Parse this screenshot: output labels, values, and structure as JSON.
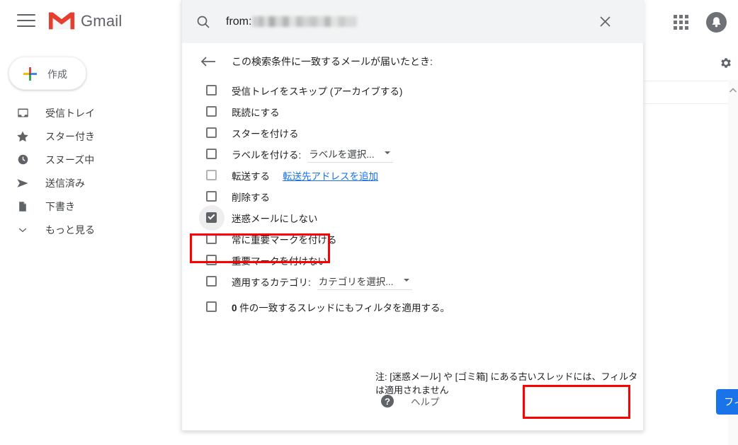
{
  "appbar": {
    "menu_icon": "hamburger-menu-icon",
    "logo_icon": "gmail-logo-icon",
    "brand": "Gmail",
    "apps_icon": "apps-grid-icon",
    "avatar_icon": "bell-avatar-icon"
  },
  "sidebar": {
    "compose": {
      "label": "作成",
      "icon": "plus-icon"
    },
    "items": [
      {
        "label": "受信トレイ",
        "icon": "inbox-icon"
      },
      {
        "label": "スター付き",
        "icon": "star-icon"
      },
      {
        "label": "スヌーズ中",
        "icon": "clock-icon"
      },
      {
        "label": "送信済み",
        "icon": "send-icon"
      },
      {
        "label": "下書き",
        "icon": "document-icon"
      },
      {
        "label": "もっと見る",
        "icon": "chevron-down-icon"
      }
    ]
  },
  "background": {
    "settings_icon": "gear-icon",
    "scroll_up_icon": "chevron-up-icon"
  },
  "search": {
    "icon": "search-icon",
    "query_prefix": "from:",
    "query_redacted": true,
    "close_icon": "close-icon"
  },
  "panel": {
    "back_icon": "back-arrow-icon",
    "title": "この検索条件に一致するメールが届いたとき:",
    "options": [
      {
        "label": "受信トレイをスキップ (アーカイブする)",
        "checked": false
      },
      {
        "label": "既読にする",
        "checked": false
      },
      {
        "label": "スターを付ける",
        "checked": false
      },
      {
        "label": "ラベルを付ける:",
        "checked": false,
        "select": "ラベルを選択..."
      },
      {
        "label": "転送する",
        "checked": false,
        "light": true,
        "link": "転送先アドレスを追加"
      },
      {
        "label": "削除する",
        "checked": false
      },
      {
        "label": "迷惑メールにしない",
        "checked": true,
        "highlighted": true
      },
      {
        "label": "常に重要マークを付ける",
        "checked": false
      },
      {
        "label": "重要マークを付けない",
        "checked": false
      },
      {
        "label": "適用するカテゴリ:",
        "checked": false,
        "select": "カテゴリを選択..."
      }
    ],
    "apply_existing": {
      "count": "0",
      "label": "件の一致するスレッドにもフィルタを適用する。",
      "checked": false
    },
    "note": "注: [迷惑メール] や [ゴミ箱] にある古いスレッドには、フィルタは適用されません",
    "help": {
      "label": "ヘルプ",
      "icon": "help-icon",
      "glyph": "?"
    },
    "create_button": "フィルタを作成"
  },
  "annotations": {
    "color": "#ff0000",
    "highlight_row": "迷惑メールにしない",
    "highlight_button": "フィルタを作成"
  }
}
